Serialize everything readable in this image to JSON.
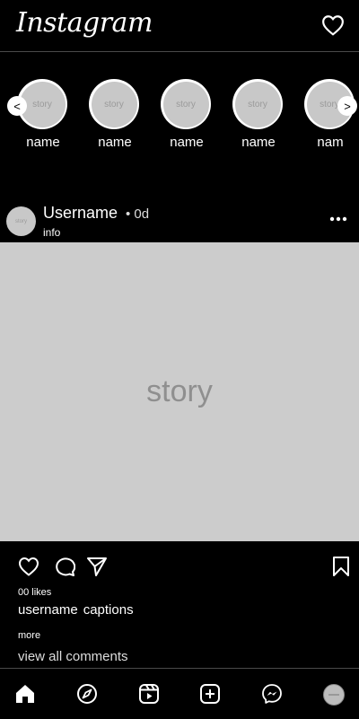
{
  "header": {
    "logo": "Instagram"
  },
  "stories": {
    "items": [
      {
        "thumb": "story",
        "name": "name"
      },
      {
        "thumb": "story",
        "name": "name"
      },
      {
        "thumb": "story",
        "name": "name"
      },
      {
        "thumb": "story",
        "name": "name"
      },
      {
        "thumb": "story",
        "name": "nam"
      }
    ],
    "prev_label": "<",
    "next_label": ">"
  },
  "post": {
    "avatar_text": "story",
    "username": "Username",
    "time": "• 0d",
    "info": "info",
    "image_text": "story",
    "likes": "00 likes",
    "caption_user": "username",
    "caption_text": "captions",
    "more": "more",
    "view_comments": "view all comments"
  }
}
